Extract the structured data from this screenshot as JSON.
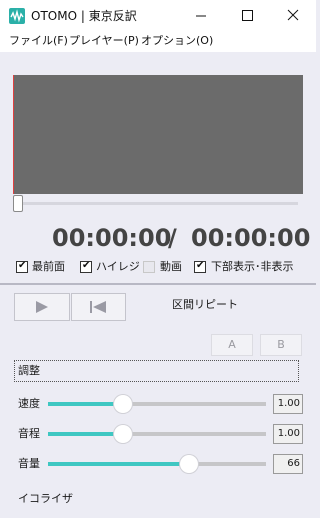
{
  "window": {
    "title": "OTOMO | 東京反訳",
    "minimize_icon": "minimize-icon",
    "maximize_icon": "maximize-icon",
    "close_icon": "close-icon"
  },
  "menu": {
    "file": "ファイル(F)",
    "player": "プレイヤー(P)",
    "options": "オプション(O)"
  },
  "player": {
    "current_time": "00:00:00",
    "separator": "/",
    "total_time": "00:00:00"
  },
  "checkboxes": [
    {
      "label": "最前面",
      "checked": true
    },
    {
      "label": "ハイレジ",
      "checked": true
    },
    {
      "label": "動画",
      "checked": false
    },
    {
      "label": "下部表示･非表示",
      "checked": true
    }
  ],
  "transport": {
    "play_icon": "play-icon",
    "rewind_icon": "skip-to-start-icon",
    "repeat_label": "区間リピート",
    "a_label": "A",
    "b_label": "B"
  },
  "adjust": {
    "group_label": "調整",
    "speed": {
      "label": "速度",
      "value": "1.00",
      "level": 0.34
    },
    "pitch": {
      "label": "音程",
      "value": "1.00",
      "level": 0.34
    },
    "volume": {
      "label": "音量",
      "value": "66",
      "level": 0.66
    }
  },
  "equalizer_label": "イコライザ",
  "colors": {
    "accent": "#3fc7c2",
    "video_background": "#6b6b6b",
    "window_background": "#ececf4"
  }
}
